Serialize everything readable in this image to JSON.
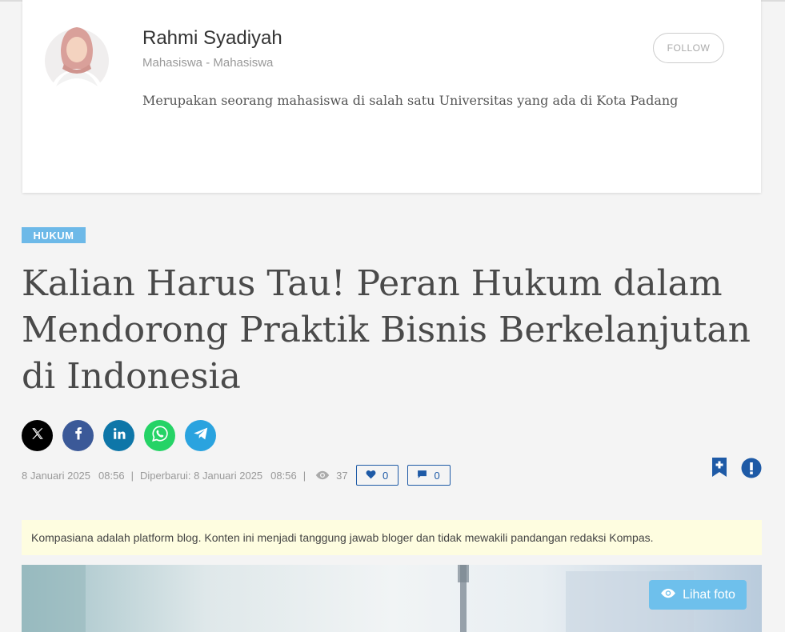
{
  "author": {
    "name": "Rahmi Syadiyah",
    "role": "Mahasiswa - Mahasiswa",
    "follow_label": "FOLLOW",
    "bio": "Merupakan seorang mahasiswa di salah satu Universitas yang ada di Kota Padang"
  },
  "article": {
    "category": "HUKUM",
    "title": "Kalian Harus Tau! Peran Hukum dalam Mendorong Praktik Bisnis Berkelanjutan di Indonesia",
    "date": "8 Januari 2025",
    "time": "08:56",
    "updated_label": "Diperbarui: 8 Januari 2025",
    "updated_time": "08:56",
    "views": "37",
    "likes": "0",
    "comments": "0"
  },
  "share": {
    "icons": [
      "x-icon",
      "facebook-icon",
      "linkedin-icon",
      "whatsapp-icon",
      "telegram-icon"
    ],
    "colors": {
      "x": "#000000",
      "facebook": "#3b5998",
      "linkedin": "#0e76a8",
      "whatsapp": "#25d366",
      "telegram": "#2aa3df"
    }
  },
  "notice": "Kompasiana adalah platform blog. Konten ini menjadi tanggung jawab bloger dan tidak mewakili pandangan redaksi Kompas.",
  "photo": {
    "button_label": "Lihat foto"
  },
  "colors": {
    "accent": "#1e5aa6",
    "category": "#6db9e8",
    "notice_bg": "#fefde0"
  }
}
